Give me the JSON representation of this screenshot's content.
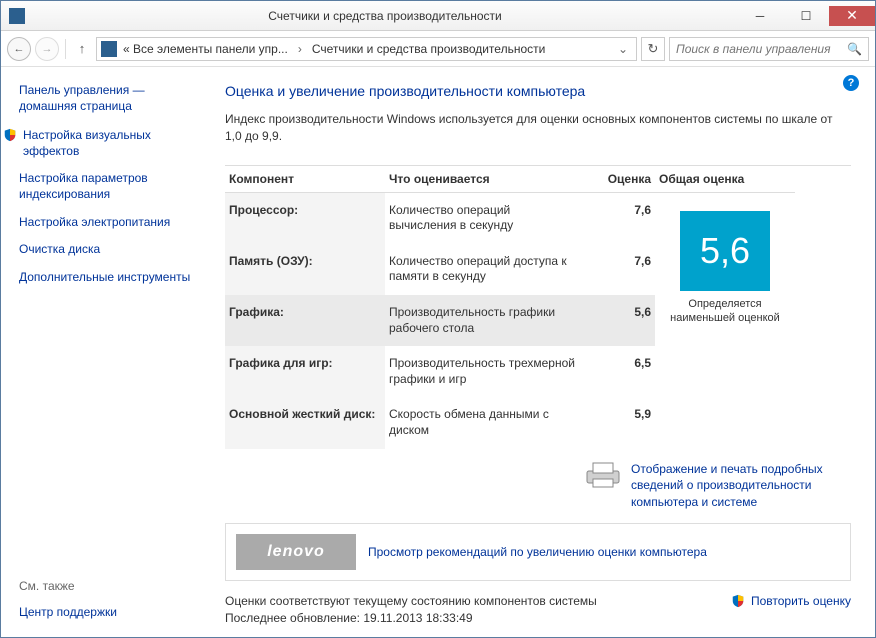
{
  "window": {
    "title": "Счетчики и средства производительности"
  },
  "breadcrumb": {
    "part1": "« Все элементы панели упр...",
    "part2": "Счетчики и средства производительности"
  },
  "search": {
    "placeholder": "Поиск в панели управления"
  },
  "sidebar": {
    "home": "Панель управления — домашняя страница",
    "links": [
      "Настройка визуальных эффектов",
      "Настройка параметров индексирования",
      "Настройка электропитания",
      "Очистка диска",
      "Дополнительные инструменты"
    ],
    "see_also_label": "См. также",
    "see_also_link": "Центр поддержки"
  },
  "main": {
    "heading": "Оценка и увеличение производительности компьютера",
    "desc": "Индекс производительности Windows используется для оценки основных компонентов системы по шкале от 1,0 до 9,9.",
    "headers": {
      "component": "Компонент",
      "what": "Что оценивается",
      "score": "Оценка",
      "base": "Общая оценка"
    },
    "rows": [
      {
        "comp": "Процессор:",
        "desc": "Количество операций вычисления в секунду",
        "score": "7,6"
      },
      {
        "comp": "Память (ОЗУ):",
        "desc": "Количество операций доступа к памяти в секунду",
        "score": "7,6"
      },
      {
        "comp": "Графика:",
        "desc": "Производительность графики рабочего стола",
        "score": "5,6"
      },
      {
        "comp": "Графика для игр:",
        "desc": "Производительность трехмерной графики и игр",
        "score": "6,5"
      },
      {
        "comp": "Основной жесткий диск:",
        "desc": "Скорость обмена данными с диском",
        "score": "5,9"
      }
    ],
    "base_score": "5,6",
    "base_note": "Определяется наименьшей оценкой",
    "print_link": "Отображение и печать подробных сведений о производительности компьютера и системе",
    "rec_logo": "lenovo",
    "rec_link": "Просмотр рекомендаций по увеличению оценки компьютера",
    "status1": "Оценки соответствуют текущему состоянию компонентов системы",
    "status2": "Последнее обновление: 19.11.2013 18:33:49",
    "rerun": "Повторить оценку"
  }
}
